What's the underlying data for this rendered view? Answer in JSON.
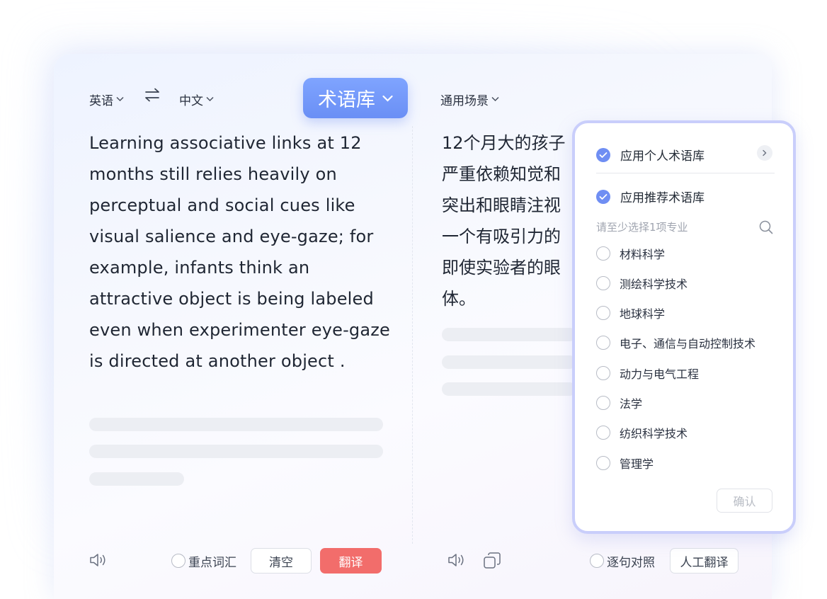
{
  "source_lang": "英语",
  "target_lang": "中文",
  "term_button": "术语库",
  "scene": "通用场景",
  "source_text": "Learning associative links at 12 months still relies heavily on perceptual and social cues like visual salience and eye-gaze; for example, infants think an attractive object is being labeled even when experimenter eye-gaze is directed at another object .",
  "target_text_lines": [
    "12个月大的孩子",
    "严重依赖知觉和",
    "突出和眼睛注视",
    "一个有吸引力的",
    "即使实验者的眼",
    "体。"
  ],
  "footer_left": {
    "key_vocab": "重点词汇",
    "clear": "清空",
    "translate": "翻译"
  },
  "footer_right": {
    "sentence_compare": "逐句对照",
    "human_translate": "人工翻译"
  },
  "panel": {
    "personal": "应用个人术语库",
    "recommended": "应用推荐术语库",
    "hint": "请至少选择1项专业",
    "options": [
      "材料科学",
      "测绘科学技术",
      "地球科学",
      "电子、通信与自动控制技术",
      "动力与电气工程",
      "法学",
      "纺织科学技术",
      "管理学"
    ],
    "confirm": "确认"
  },
  "colors": {
    "accent": "#6f8ef3",
    "translate_button": "#f26d6b",
    "panel_border": "#c9cefb"
  },
  "icons": [
    "swap-icon",
    "chevron-down-icon",
    "speaker-icon",
    "copy-icon",
    "check-icon",
    "chevron-right-icon",
    "search-icon"
  ]
}
